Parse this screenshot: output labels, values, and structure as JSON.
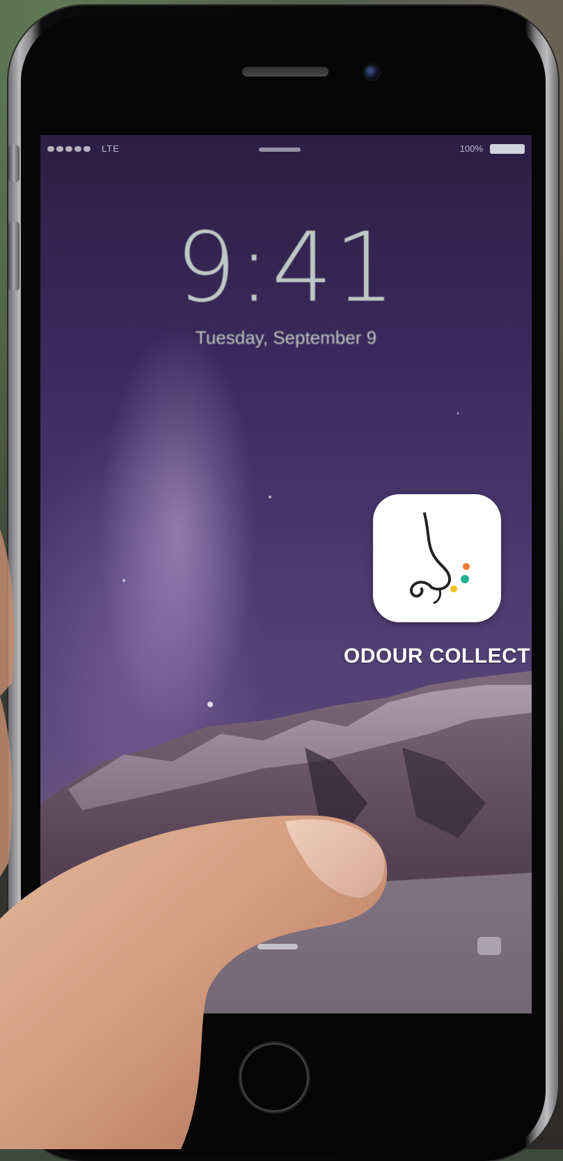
{
  "status_bar": {
    "carrier": "LTE",
    "battery": "100%"
  },
  "lock_screen": {
    "time": "9:41",
    "date": "Tuesday, September 9"
  },
  "app": {
    "name": "ODOUR COLLECT",
    "icon": "nose-icon",
    "dot_colors": [
      "#f07a2e",
      "#1fae8f",
      "#f2c320"
    ]
  }
}
